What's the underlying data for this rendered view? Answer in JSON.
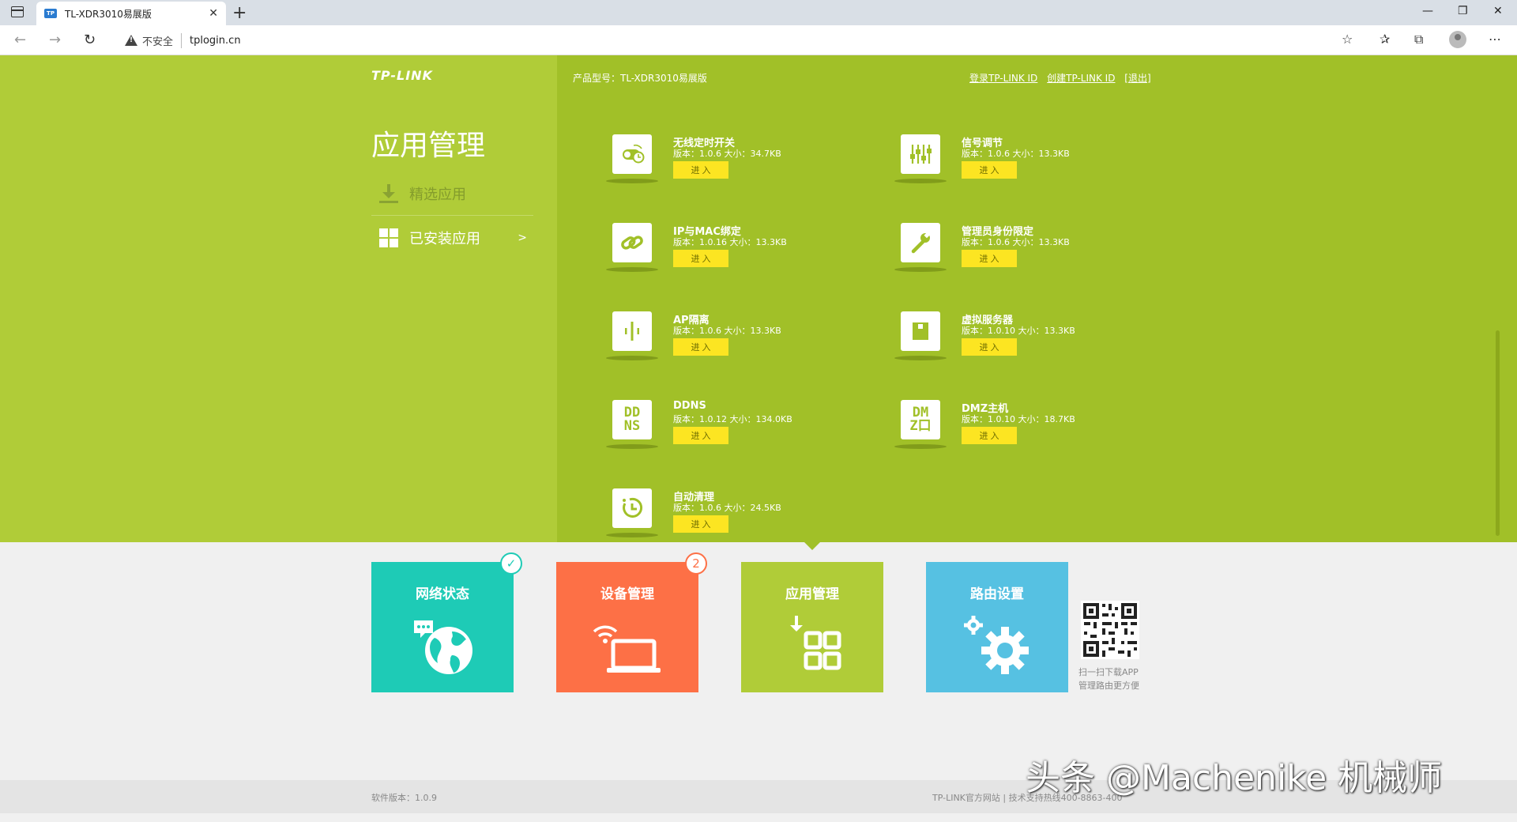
{
  "browser": {
    "tab_title": "TL-XDR3010易展版",
    "favicon_text": "TP",
    "insecure_label": "不安全",
    "url": "tplogin.cn"
  },
  "sidebar": {
    "logo": "TP-LINK",
    "title": "应用管理",
    "items": [
      {
        "label": "精选应用"
      },
      {
        "label": "已安装应用",
        "arrow": ">"
      }
    ]
  },
  "header": {
    "model": "产品型号：TL-XDR3010易展版",
    "links": [
      "登录TP-LINK ID",
      "创建TP-LINK ID",
      "[退出]"
    ]
  },
  "apps": [
    {
      "name": "无线定时开关",
      "meta": "版本：1.0.6  大小：34.7KB",
      "button": "进 入",
      "icon": "wifi-timer-icon"
    },
    {
      "name": "信号调节",
      "meta": "版本：1.0.6  大小：13.3KB",
      "button": "进 入",
      "icon": "signal-adjust-icon"
    },
    {
      "name": "IP与MAC绑定",
      "meta": "版本：1.0.16  大小：13.3KB",
      "button": "进 入",
      "icon": "link-icon"
    },
    {
      "name": "管理员身份限定",
      "meta": "版本：1.0.6  大小：13.3KB",
      "button": "进 入",
      "icon": "wrench-icon"
    },
    {
      "name": "AP隔离",
      "meta": "版本：1.0.6  大小：13.3KB",
      "button": "进 入",
      "icon": "ap-isolation-icon"
    },
    {
      "name": "虚拟服务器",
      "meta": "版本：1.0.10  大小：13.3KB",
      "button": "进 入",
      "icon": "virtual-server-icon"
    },
    {
      "name": "DDNS",
      "meta": "版本：1.0.12  大小：134.0KB",
      "button": "进 入",
      "icon": "ddns-icon",
      "icon_text": [
        "DD",
        "NS"
      ]
    },
    {
      "name": "DMZ主机",
      "meta": "版本：1.0.10  大小：18.7KB",
      "button": "进 入",
      "icon": "dmz-icon",
      "icon_text": [
        "DM",
        "Z口"
      ]
    },
    {
      "name": "自动清理",
      "meta": "版本：1.0.6  大小：24.5KB",
      "button": "进 入",
      "icon": "auto-clean-icon"
    }
  ],
  "tiles": [
    {
      "label": "网络状态",
      "color": "#1ecbb6",
      "badge": "✓"
    },
    {
      "label": "设备管理",
      "color": "#fd7046",
      "badge": "2"
    },
    {
      "label": "应用管理",
      "color": "#b0cc38"
    },
    {
      "label": "路由设置",
      "color": "#56c1e2"
    }
  ],
  "qr_text": [
    "扫一扫下载APP",
    "管理路由更方便"
  ],
  "footer": {
    "version": "软件版本：1.0.9",
    "links": "TP-LINK官方网站  |  技术支持热线400-8863-400"
  },
  "watermark": "头条 @Machenike 机械师",
  "colors": {
    "left_panel": "#b0cc38",
    "right_panel": "#a1c028",
    "button": "#fce522"
  }
}
